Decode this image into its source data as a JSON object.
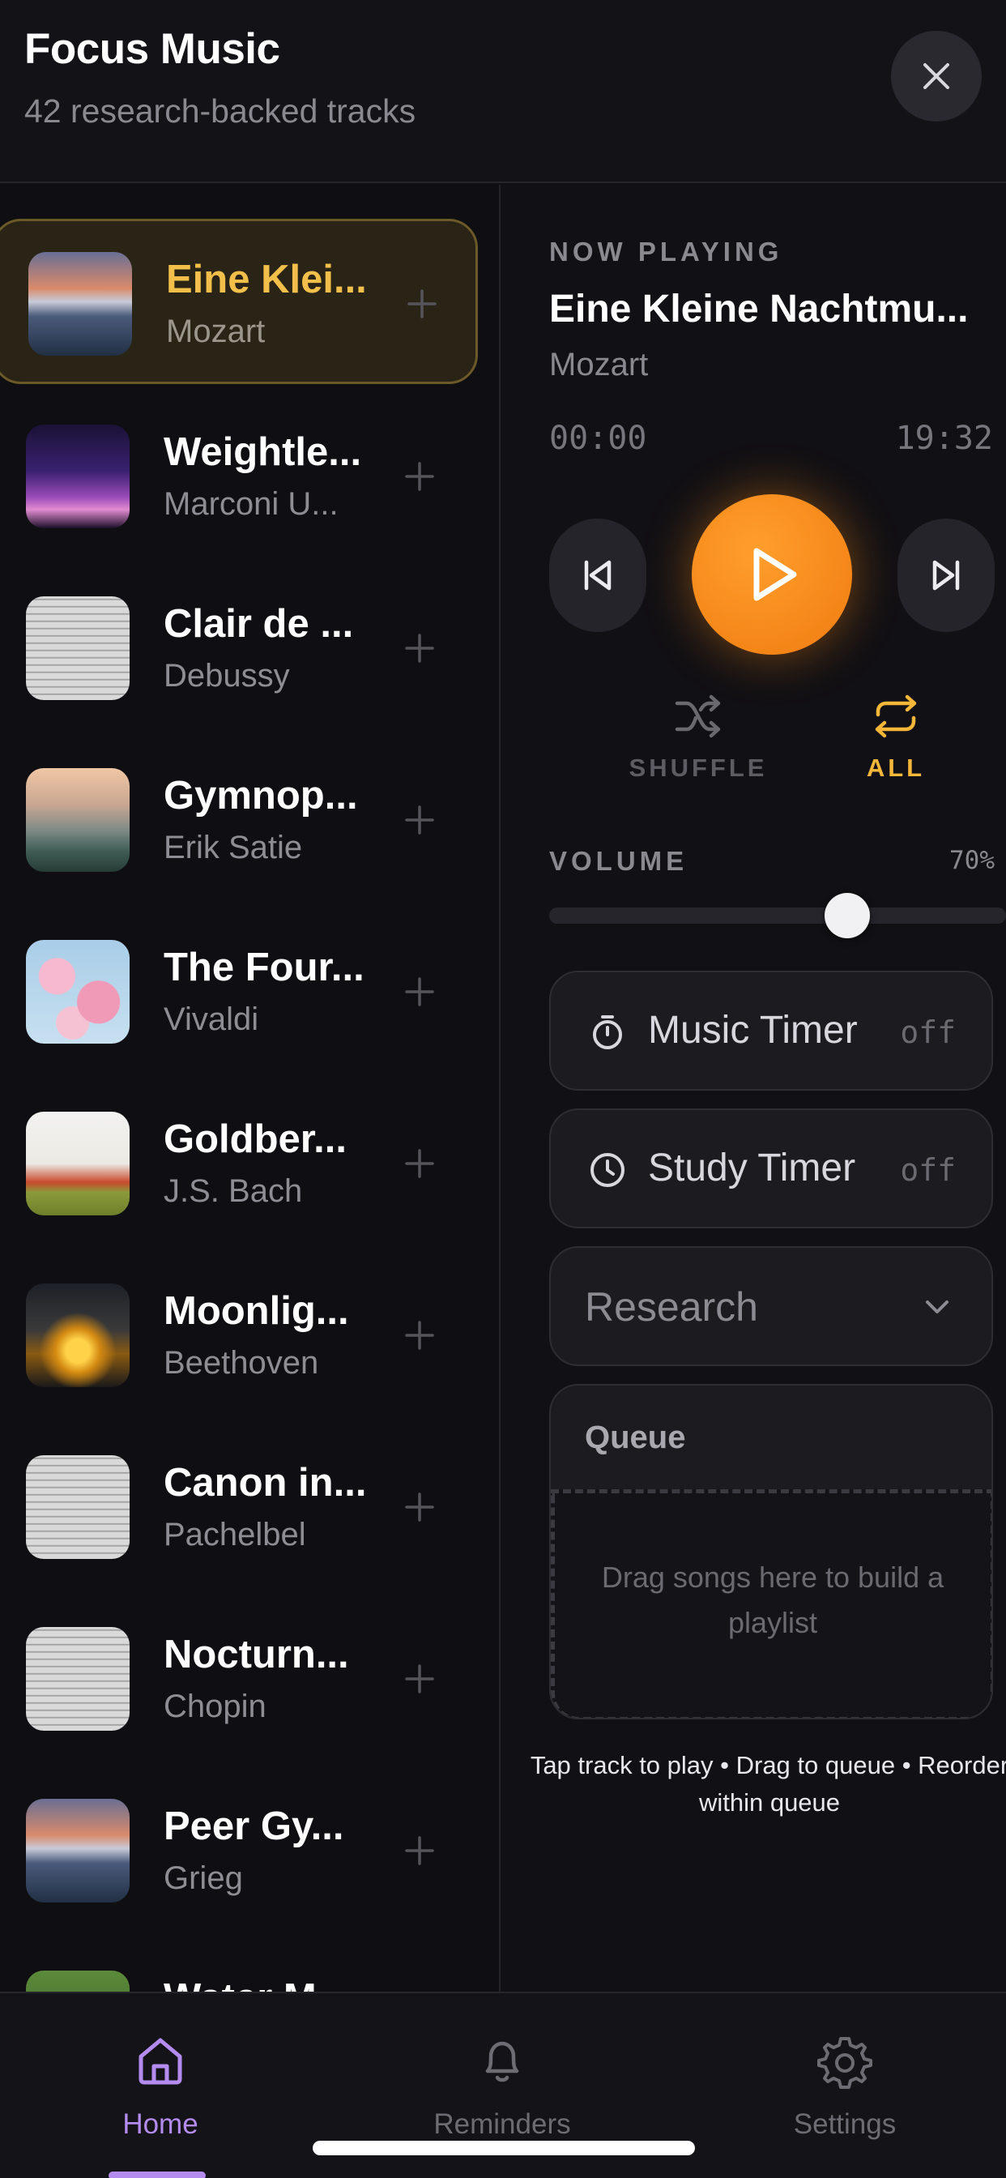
{
  "header": {
    "title": "Focus Music",
    "subtitle": "42 research-backed tracks",
    "close_icon": "close-icon"
  },
  "tracks": [
    {
      "title": "Eine Klei...",
      "artist": "Mozart",
      "active": true,
      "art": "mountain-lake"
    },
    {
      "title": "Weightle...",
      "artist": "Marconi U...",
      "active": false,
      "art": "purple-night-sky"
    },
    {
      "title": "Clair de ...",
      "artist": "Debussy",
      "active": false,
      "art": "sheet-music"
    },
    {
      "title": "Gymnop...",
      "artist": "Erik Satie",
      "active": false,
      "art": "misty-hills"
    },
    {
      "title": "The Four...",
      "artist": "Vivaldi",
      "active": false,
      "art": "cherry-blossom"
    },
    {
      "title": "Goldber...",
      "artist": "J.S. Bach",
      "active": false,
      "art": "wildflower-field"
    },
    {
      "title": "Moonlig...",
      "artist": "Beethoven",
      "active": false,
      "art": "concert-lights"
    },
    {
      "title": "Canon in...",
      "artist": "Pachelbel",
      "active": false,
      "art": "sheet-music"
    },
    {
      "title": "Nocturn...",
      "artist": "Chopin",
      "active": false,
      "art": "sheet-music"
    },
    {
      "title": "Peer Gy...",
      "artist": "Grieg",
      "active": false,
      "art": "mountain-lake"
    },
    {
      "title": "Water M...",
      "artist": "",
      "active": false,
      "art": "green-foliage"
    }
  ],
  "now_playing": {
    "label": "NOW PLAYING",
    "title": "Eine Kleine Nachtmu...",
    "artist": "Mozart",
    "time_current": "00:00",
    "time_total": "19:32"
  },
  "controls": {
    "prev_icon": "skip-previous-icon",
    "play_icon": "play-icon",
    "next_icon": "skip-next-icon",
    "shuffle_label": "SHUFFLE",
    "repeat_label": "ALL",
    "accent": "#f4b73a",
    "play_color": "#f7901a"
  },
  "volume": {
    "label": "VOLUME",
    "value_text": "70%",
    "level": 0.7
  },
  "timers": {
    "music_label": "Music Timer",
    "music_state": "off",
    "study_label": "Study Timer",
    "study_state": "off"
  },
  "category_select": {
    "selected": "Research"
  },
  "queue": {
    "title": "Queue",
    "empty_text": "Drag songs here to build a playlist"
  },
  "hint": "Tap track to play • Drag to queue • Reorder within queue",
  "nav": {
    "home": "Home",
    "reminders": "Reminders",
    "settings": "Settings",
    "active": "home",
    "active_color": "#b48cf0"
  }
}
